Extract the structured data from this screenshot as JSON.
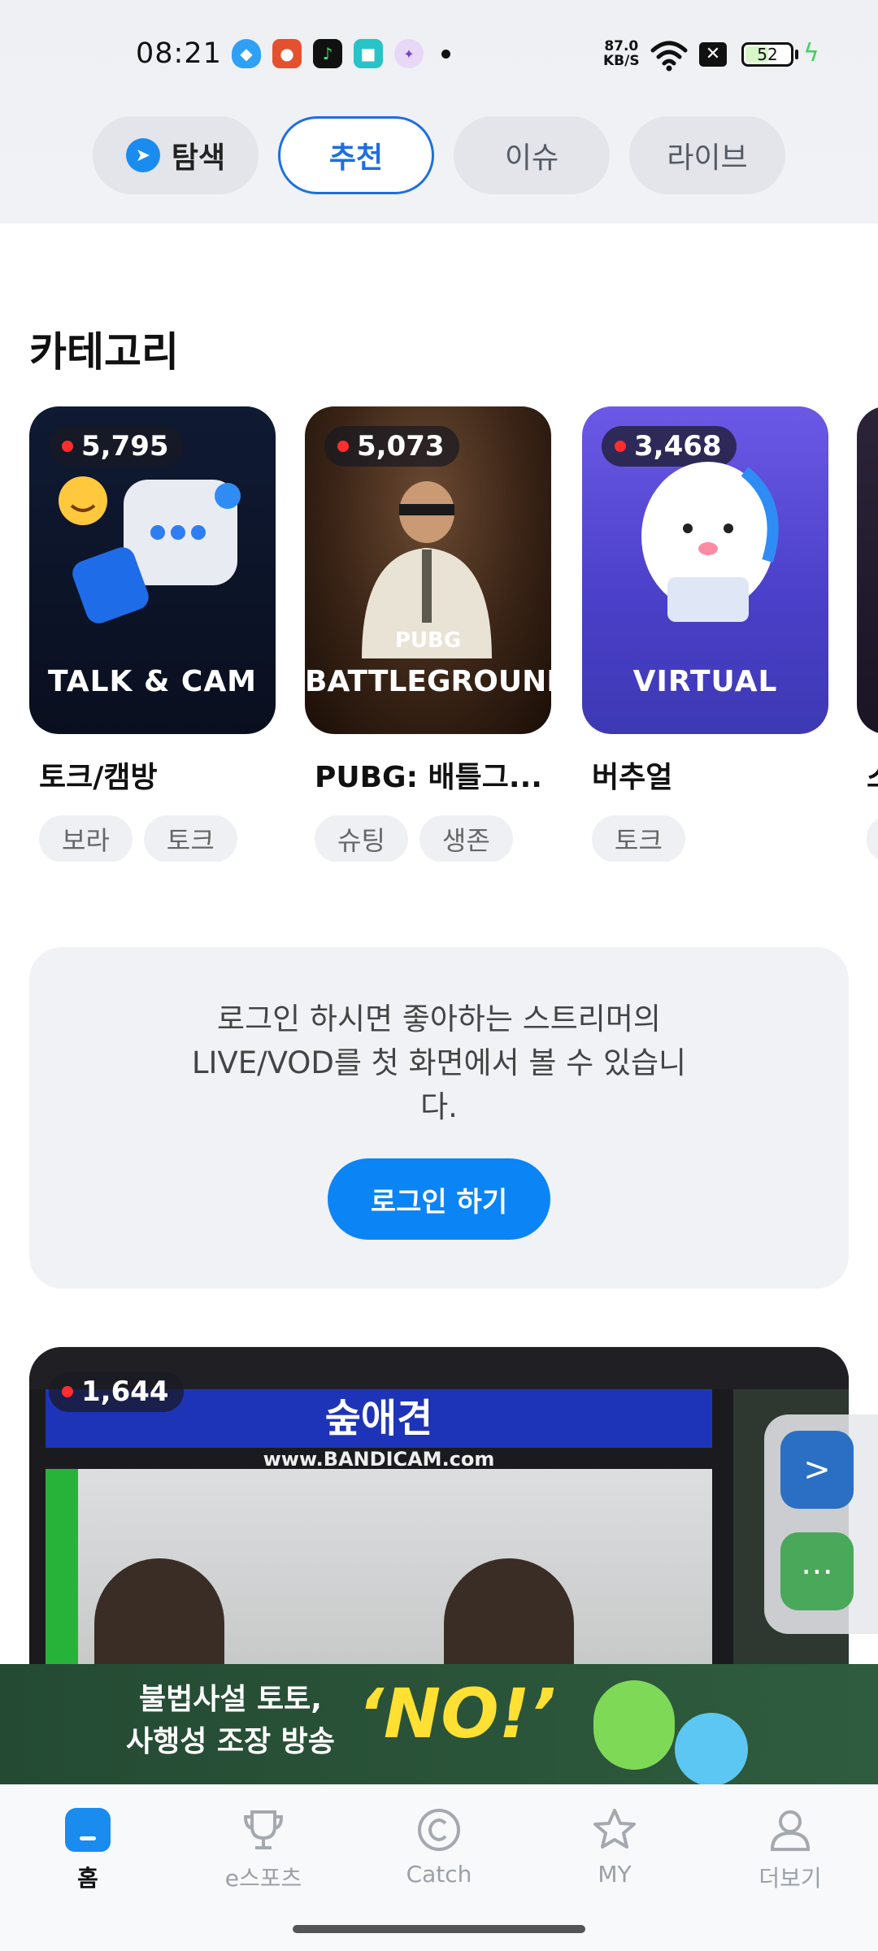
{
  "status_bar": {
    "time": "08:21",
    "notif_icons": [
      "qq-icon",
      "app-icon",
      "music-icon",
      "magic-icon",
      "sticker-icon"
    ],
    "net_speed_value": "87.0",
    "net_speed_unit": "KB/S",
    "battery_level": "52",
    "battery_fraction": 0.52
  },
  "top_tabs": {
    "explore": "탐색",
    "recommend": "추천",
    "issue": "이슈",
    "live": "라이브",
    "active": "recommend"
  },
  "category_section": {
    "title": "카테고리",
    "cards": [
      {
        "viewers": "5,795",
        "caption": "TALK & CAM",
        "name": "토크/캠방",
        "tags": [
          "보라",
          "토크"
        ]
      },
      {
        "viewers": "5,073",
        "caption": "BATTLEGROUNDS",
        "caption_small": "PUBG",
        "name": "PUBG: 배틀그...",
        "tags": [
          "슈팅",
          "생존"
        ]
      },
      {
        "viewers": "3,468",
        "caption": "VIRTUAL",
        "name": "버추얼",
        "tags": [
          "토크"
        ]
      },
      {
        "viewers": "",
        "caption": "",
        "name": "스",
        "tags": [
          ""
        ]
      }
    ]
  },
  "login_card": {
    "message": "로그인 하시면 좋아하는 스트리머의 LIVE/VOD를 첫 화면에서 볼 수 있습니다.",
    "button": "로그인 하기"
  },
  "live_stream": {
    "viewers": "1,644",
    "header_text": "숲애견",
    "watermark": "www.BANDICAM.com"
  },
  "banner": {
    "line1": "불법사설 토토,",
    "line2": "사행성 조장 방송",
    "slogan": "‘NO!’"
  },
  "bottom_nav": {
    "home": "홈",
    "esports": "e스포츠",
    "catch": "Catch",
    "my": "MY",
    "more": "더보기"
  },
  "colors": {
    "accent": "#0b84f5",
    "live_dot": "#ff2d2d",
    "active_tab_border": "#1d6fe0"
  }
}
